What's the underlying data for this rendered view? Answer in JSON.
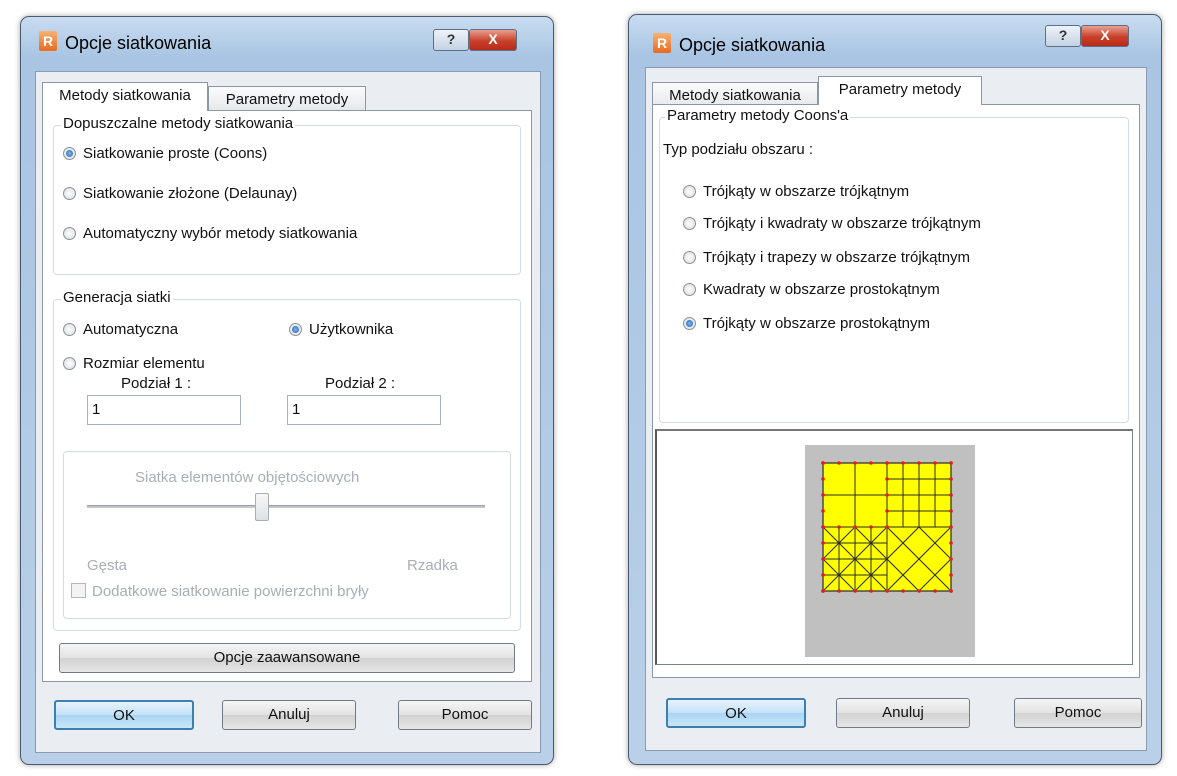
{
  "dialog1": {
    "title": "Opcje siatkowania",
    "app_icon": "R",
    "help_icon": "?",
    "close_icon": "X",
    "tabs": [
      {
        "label": "Metody siatkowania",
        "active": true
      },
      {
        "label": "Parametry metody",
        "active": false
      }
    ],
    "methods_group": {
      "legend": "Dopuszczalne metody siatkowania",
      "options": [
        {
          "label": "Siatkowanie proste (Coons)",
          "checked": true
        },
        {
          "label": "Siatkowanie złożone (Delaunay)",
          "checked": false
        },
        {
          "label": "Automatyczny wybór metody siatkowania",
          "checked": false
        }
      ]
    },
    "generation_group": {
      "legend": "Generacja siatki",
      "options": [
        {
          "label": "Automatyczna",
          "checked": false
        },
        {
          "label": "Użytkownika",
          "checked": true
        },
        {
          "label": "Rozmiar elementu",
          "checked": false
        }
      ],
      "division1_label": "Podział 1 :",
      "division1_value": "1",
      "division2_label": "Podział 2 :",
      "division2_value": "1"
    },
    "volume_group": {
      "legend": "Siatka elementów objętościowych",
      "left_label": "Gęsta",
      "right_label": "Rzadka",
      "checkbox_label": "Dodatkowe siatkowanie powierzchni bryły",
      "checkbox_checked": false,
      "enabled": false
    },
    "advanced_button": "Opcje zaawansowane",
    "buttons": {
      "ok": "OK",
      "cancel": "Anuluj",
      "help": "Pomoc"
    }
  },
  "dialog2": {
    "title": "Opcje siatkowania",
    "app_icon": "R",
    "help_icon": "?",
    "close_icon": "X",
    "tabs": [
      {
        "label": "Metody siatkowania",
        "active": false
      },
      {
        "label": "Parametry metody",
        "active": true
      }
    ],
    "coons_group": {
      "legend": "Parametry metody Coons'a",
      "division_label": "Typ podziału obszaru :",
      "options": [
        {
          "label": "Trójkąty w obszarze trójkątnym",
          "checked": false
        },
        {
          "label": "Trójkąty i kwadraty w obszarze trójkątnym",
          "checked": false
        },
        {
          "label": "Trójkąty i trapezy w obszarze trójkątnym",
          "checked": false
        },
        {
          "label": "Kwadraty w obszarze prostokątnym",
          "checked": false
        },
        {
          "label": "Trójkąty w obszarze prostokątnym",
          "checked": true
        }
      ]
    },
    "buttons": {
      "ok": "OK",
      "cancel": "Anuluj",
      "help": "Pomoc"
    }
  },
  "colors": {
    "mesh_fill": "#ffff00",
    "mesh_line": "#2a2a2a",
    "mesh_node": "#e02020",
    "preview_bg": "#c0c0c0"
  }
}
